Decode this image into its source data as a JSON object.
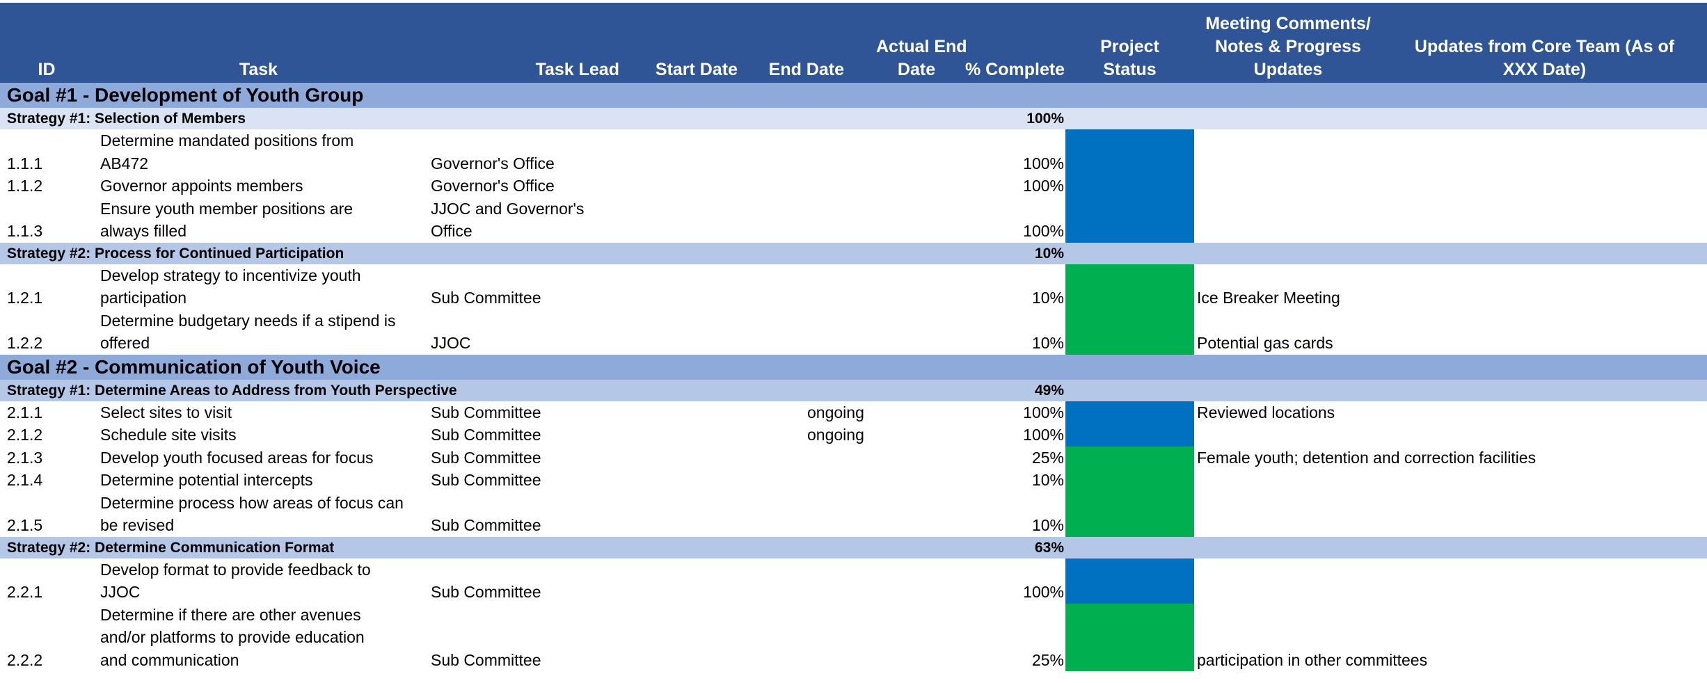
{
  "headers": {
    "id": "ID",
    "task": "Task",
    "task_lead": "Task Lead",
    "start_date": "Start Date",
    "end_date": "End Date",
    "actual_end_1": "Actual End",
    "actual_end_2": "Date",
    "pct_complete": "% Complete",
    "status_1": "Project",
    "status_2": "Status",
    "meeting_1": "Meeting Comments/",
    "meeting_2": "Notes & Progress",
    "meeting_3": "Updates",
    "updates_1": "Updates from Core Team (As of",
    "updates_2": "XXX Date)"
  },
  "colors": {
    "header_bg": "#2f5597",
    "goal_bg": "#8eaadb",
    "strategy_bg": "#b4c7e7",
    "strategy_light_bg": "#dae3f3",
    "status_complete": "#0070c0",
    "status_in_progress": "#00b050"
  },
  "goal1": {
    "title": "Goal #1 - Development of Youth Group",
    "strategy1": {
      "title": "Strategy #1: Selection of Members",
      "pct": "100%",
      "tasks": [
        {
          "id": "1.1.1",
          "task1": "Determine mandated positions from",
          "task2": "AB472",
          "lead1": "",
          "lead2": "Governor's Office",
          "pct": "100%",
          "status": "blue"
        },
        {
          "id": "1.1.2",
          "task1": "Governor appoints members",
          "lead1": "Governor's Office",
          "pct": "100%",
          "status": "blue"
        },
        {
          "id": "1.1.3",
          "task1": "Ensure youth member positions are",
          "task2": "always filled",
          "lead1": "JJOC and Governor's",
          "lead2": "Office",
          "pct": "100%",
          "status": "blue"
        }
      ]
    },
    "strategy2": {
      "title": "Strategy #2: Process for Continued Participation",
      "pct": "10%",
      "tasks": [
        {
          "id": "1.2.1",
          "task1": "Develop strategy to incentivize youth",
          "task2": "participation",
          "lead": "Sub Committee",
          "pct": "10%",
          "status": "green",
          "comment": "Ice Breaker Meeting"
        },
        {
          "id": "1.2.2",
          "task1": "Determine budgetary needs if a stipend is",
          "task2": "offered",
          "lead": "JJOC",
          "pct": "10%",
          "status": "green",
          "comment": "Potential gas cards"
        }
      ]
    }
  },
  "goal2": {
    "title": "Goal #2 - Communication of Youth Voice",
    "strategy1": {
      "title": "Strategy #1: Determine Areas to Address from Youth Perspective",
      "pct": "49%",
      "tasks": [
        {
          "id": "2.1.1",
          "task": "Select sites to visit",
          "lead": "Sub Committee",
          "actual_end": "ongoing",
          "pct": "100%",
          "status": "blue",
          "comment": "Reviewed locations"
        },
        {
          "id": "2.1.2",
          "task": "Schedule site visits",
          "lead": "Sub Committee",
          "actual_end": "ongoing",
          "pct": "100%",
          "status": "blue",
          "comment": ""
        },
        {
          "id": "2.1.3",
          "task": "Develop youth focused areas for focus",
          "lead": "Sub Committee",
          "pct": "25%",
          "status": "green",
          "comment": "Female youth; detention and correction facilities"
        },
        {
          "id": "2.1.4",
          "task": "Determine potential intercepts",
          "lead": "Sub Committee",
          "pct": "10%",
          "status": "green",
          "comment": ""
        },
        {
          "id": "2.1.5",
          "task1": "Determine process how areas of focus can",
          "task2": "be revised",
          "lead": "Sub Committee",
          "pct": "10%",
          "status": "green",
          "comment": ""
        }
      ]
    },
    "strategy2": {
      "title": "Strategy #2: Determine Communication Format",
      "pct": "63%",
      "tasks": [
        {
          "id": "2.2.1",
          "task1": "Develop format to provide feedback to",
          "task2": "JJOC",
          "lead": "Sub Committee",
          "pct": "100%",
          "status": "blue",
          "comment": ""
        },
        {
          "id": "2.2.2",
          "task1": "Determine if there are other avenues",
          "task2": "and/or platforms to provide education",
          "task3": "and communication",
          "lead": "Sub Committee",
          "pct": "25%",
          "status": "green",
          "comment": "participation in other committees"
        }
      ]
    }
  }
}
